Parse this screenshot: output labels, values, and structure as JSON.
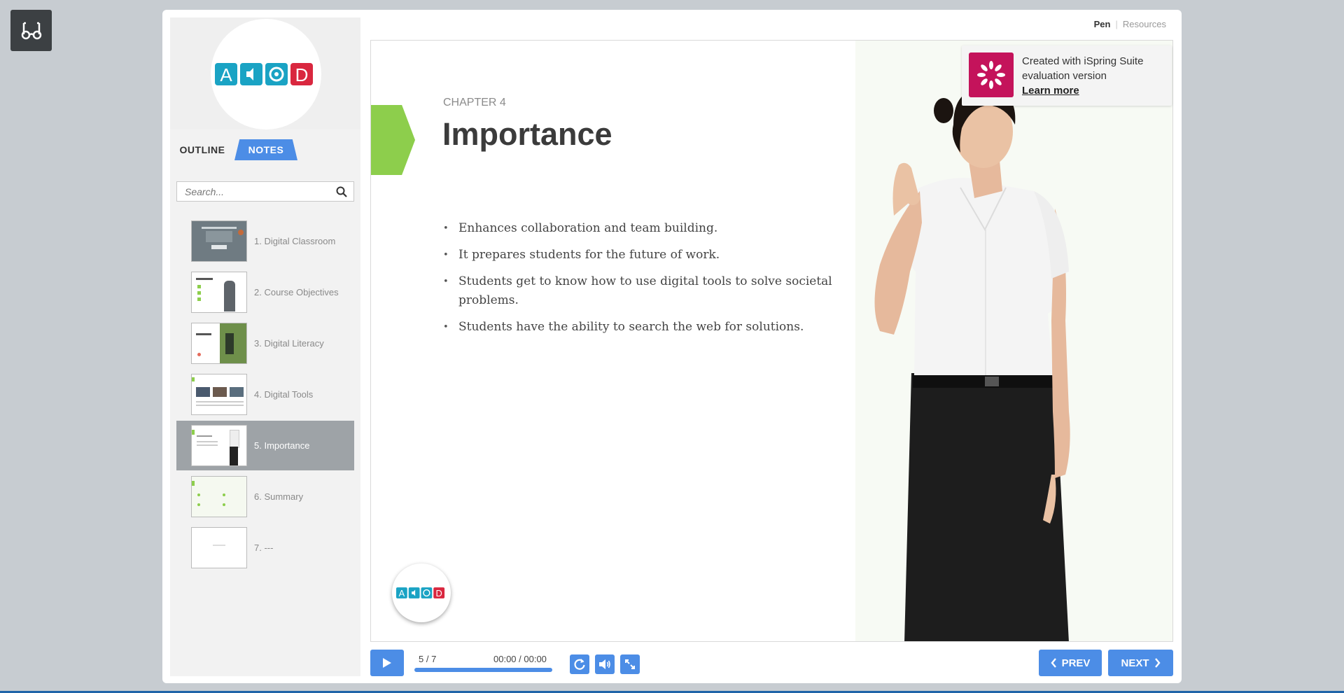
{
  "header": {
    "links": [
      "Pen",
      "Resources"
    ]
  },
  "sidebar": {
    "tabs": [
      "OUTLINE",
      "NOTES"
    ],
    "active_tab": "NOTES",
    "search": {
      "placeholder": "Search..."
    },
    "slides": [
      {
        "label": "1. Digital Classroom"
      },
      {
        "label": "2. Course Objectives"
      },
      {
        "label": "3. Digital Literacy"
      },
      {
        "label": "4. Digital Tools"
      },
      {
        "label": "5. Importance"
      },
      {
        "label": "6. Summary"
      },
      {
        "label": "7. ---"
      }
    ],
    "active_slide": 5
  },
  "slide": {
    "chapter": "CHAPTER 4",
    "title": "Importance",
    "bullets": [
      "Enhances collaboration and team building.",
      "It prepares students for the future of work.",
      "Students get to know how to use digital tools to solve societal problems.",
      "Students have the ability to search the web for solutions."
    ]
  },
  "badge": {
    "line1": "Created with iSpring Suite",
    "line2": "evaluation version",
    "link": "Learn more"
  },
  "controls": {
    "counter": "5 / 7",
    "time": "00:00 / 00:00",
    "progress_fraction": 1.0,
    "prev_label": "PREV",
    "next_label": "NEXT"
  },
  "colors": {
    "accent": "#4c8de6",
    "chapter_marker": "#8dce4c",
    "ispring_brand": "#c4135b",
    "active_row": "#9ea3a7"
  },
  "icons": [
    "reader-mode-icon",
    "search-icon",
    "play-icon",
    "replay-icon",
    "volume-icon",
    "fullscreen-icon",
    "chevron-left-icon",
    "chevron-right-icon",
    "ispring-logo-icon"
  ]
}
